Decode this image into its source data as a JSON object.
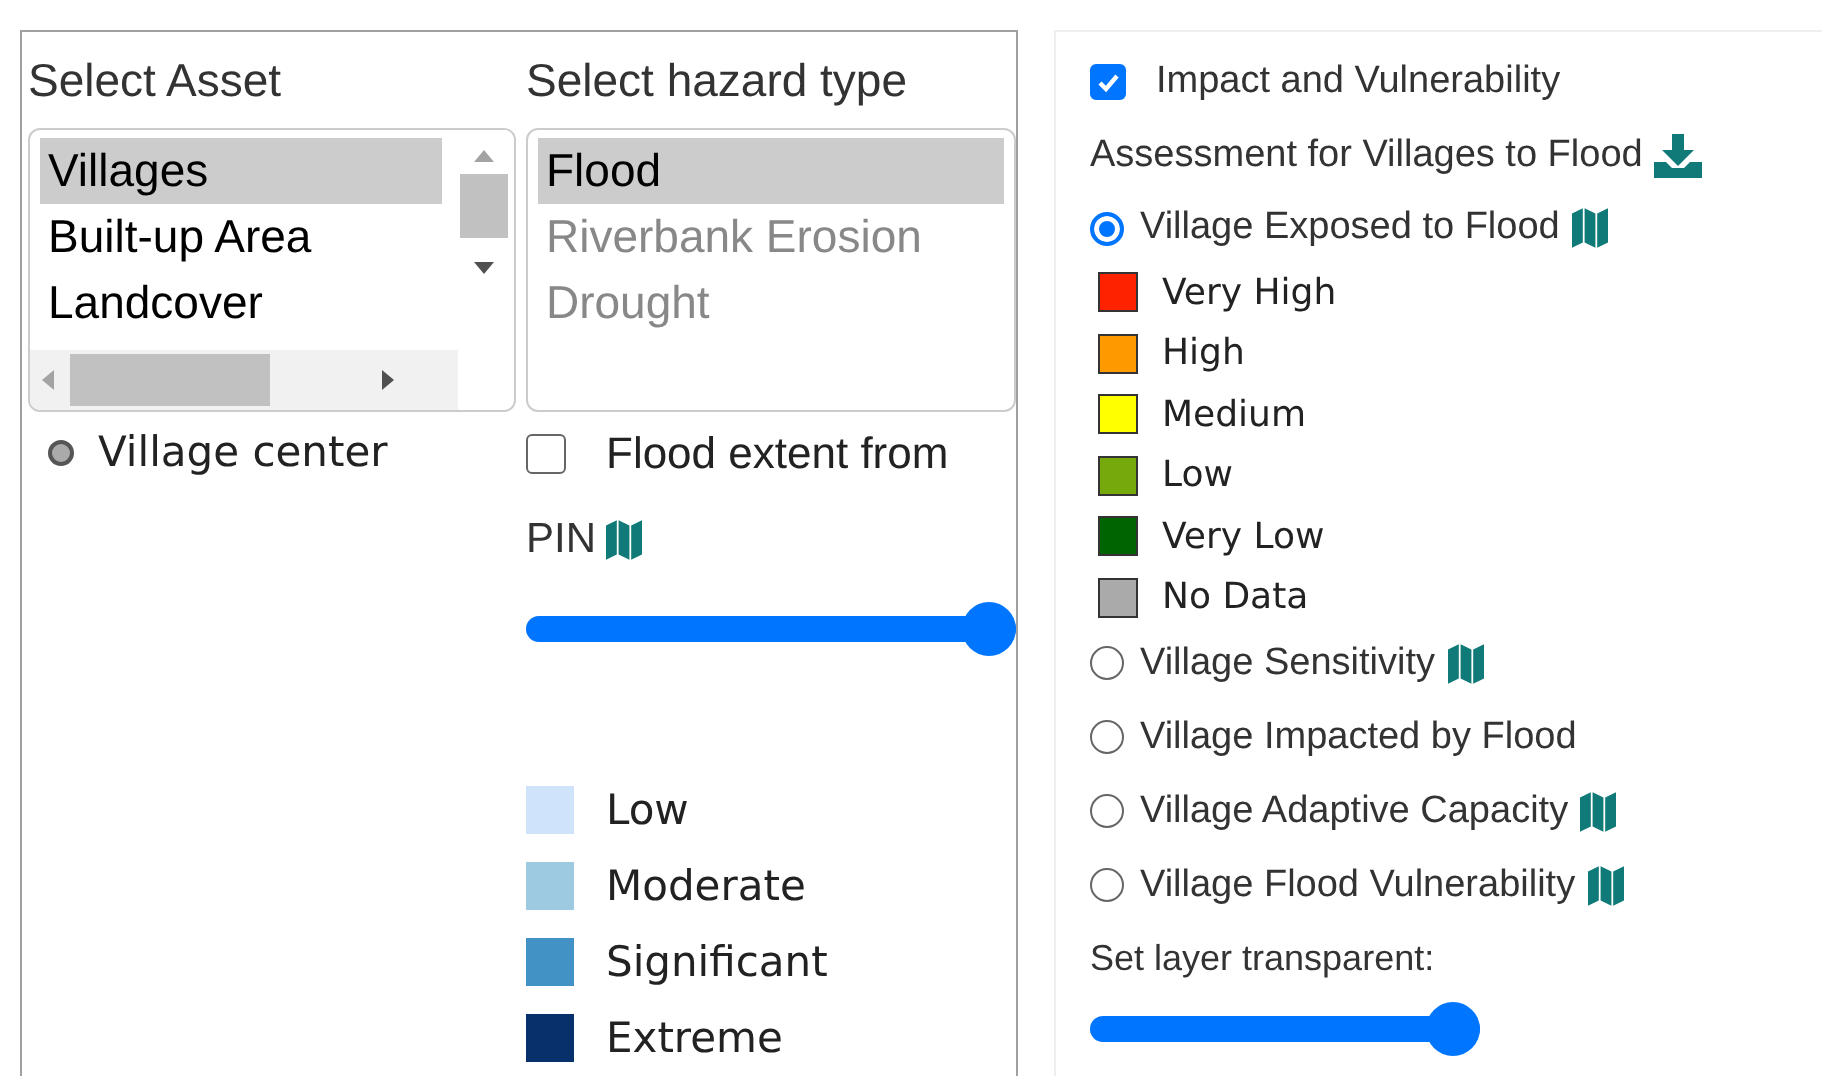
{
  "asset_panel": {
    "title": "Select Asset",
    "options": [
      {
        "label": "Villages",
        "selected": true
      },
      {
        "label": "Built-up Area",
        "selected": false
      },
      {
        "label": "Landcover",
        "selected": false
      }
    ],
    "point_legend": {
      "label": "Village center"
    }
  },
  "hazard_panel": {
    "title": "Select hazard type",
    "options": [
      {
        "label": "Flood",
        "selected": true,
        "disabled": false
      },
      {
        "label": "Riverbank Erosion",
        "selected": false,
        "disabled": true
      },
      {
        "label": "Drought",
        "selected": false,
        "disabled": true
      }
    ],
    "flood_extent": {
      "label": "Flood extent from",
      "checked": false
    },
    "pin": {
      "label": "PIN"
    },
    "pin_slider": {
      "level": 1
    },
    "legend": [
      {
        "label": "Low",
        "color": "#cfe4fa"
      },
      {
        "label": "Moderate",
        "color": "#9ecae1"
      },
      {
        "label": "Significant",
        "color": "#4292c6"
      },
      {
        "label": "Extreme",
        "color": "#08306b"
      }
    ]
  },
  "impact_panel": {
    "toggle": {
      "label": "Impact and Vulnerability",
      "checked": true
    },
    "heading": "Assessment for Villages to Flood",
    "layers": [
      {
        "label": "Village Exposed to Flood",
        "selected": true,
        "has_map": true,
        "legend": [
          {
            "label": "Very High",
            "color": "#ff2200"
          },
          {
            "label": "High",
            "color": "#ff9900"
          },
          {
            "label": "Medium",
            "color": "#ffff00"
          },
          {
            "label": "Low",
            "color": "#76a90c"
          },
          {
            "label": "Very Low",
            "color": "#006400"
          },
          {
            "label": "No Data",
            "color": "#aaaaaa"
          }
        ]
      },
      {
        "label": "Village Sensitivity",
        "selected": false,
        "has_map": true
      },
      {
        "label": "Village Impacted by Flood",
        "selected": false,
        "has_map": false
      },
      {
        "label": "Village Adaptive Capacity",
        "selected": false,
        "has_map": true
      },
      {
        "label": "Village Flood Vulnerability",
        "selected": false,
        "has_map": true
      }
    ],
    "transparency": {
      "label": "Set layer transparent:",
      "level": 1
    }
  }
}
